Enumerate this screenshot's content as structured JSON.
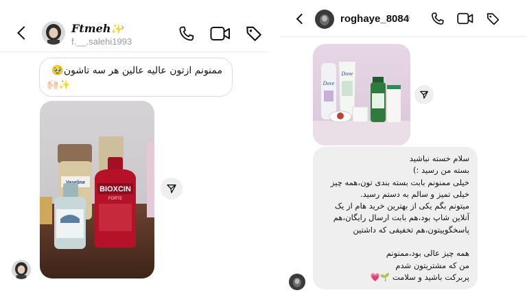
{
  "left_chat": {
    "username": "Ftmeh",
    "username_emoji": "✨",
    "handle": "f.__.salehi1993",
    "message_line1": "ممنونم ازتون  عالیه عالین هر سه تاشون🥹",
    "message_line2": "🙌🏻✨"
  },
  "right_chat": {
    "username": "roghaye_8084",
    "message_lines": [
      "سلام خسته نباشید",
      "بسته من رسید :)",
      "خیلی ممنونم بابت بسته بندی تون،همه چیز",
      "خیلی تمیز و سالم به دستم رسید.",
      "میتونم بگم یکی از بهترین خرید هام از یک",
      "آنلاین شاپ بود،هم بابت ارسال رایگان،هم",
      "پاسخگوییتون،هم تخفیفی که داشتین",
      "",
      "همه چیز عالی بود،ممنونم",
      "من که مشتریتون شدم",
      "پربرکت باشید و سلامت 🌱💗"
    ]
  },
  "product_labels": {
    "vaseline": "Vaseline",
    "bioxcin": "BIOXCIN",
    "forte": "FORTE",
    "dove_left": "Dove",
    "dove_right": "Dove"
  },
  "colors": {
    "bubble_grey": "#efefef",
    "text": "#111111",
    "muted": "#9a9a9a",
    "bioxcin_red": "#b5122a"
  },
  "icons": [
    "back-icon",
    "chevron-right-icon",
    "phone-icon",
    "video-icon",
    "tag-icon",
    "share-icon"
  ]
}
